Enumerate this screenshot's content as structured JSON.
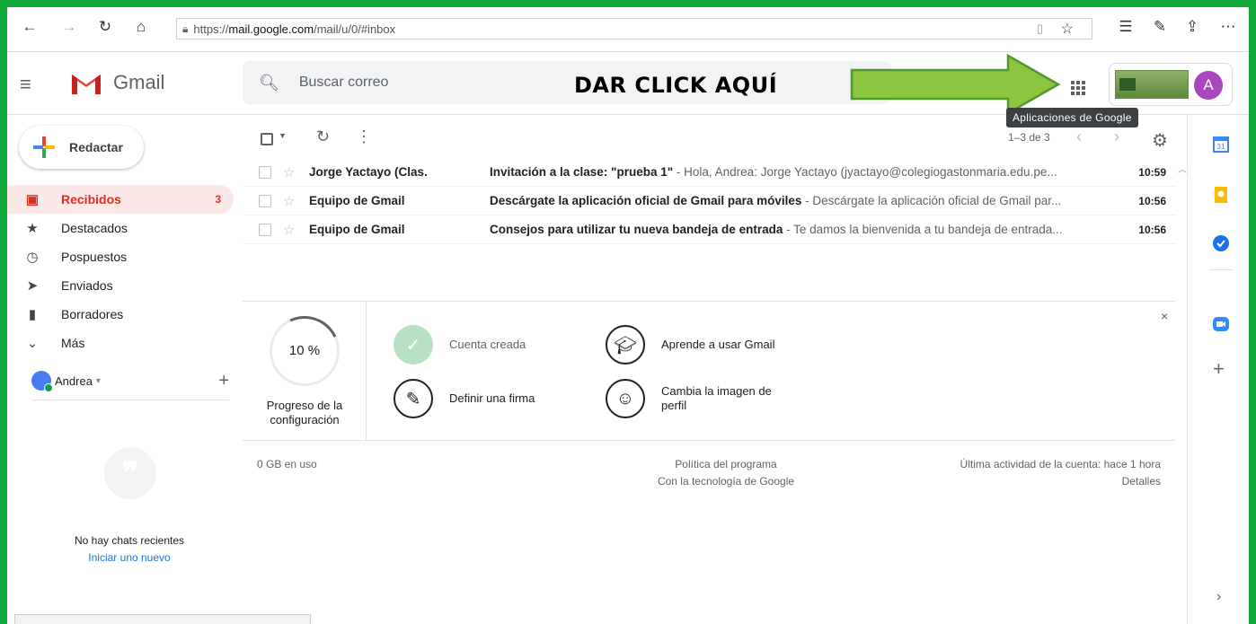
{
  "browser": {
    "url_prefix": "https://",
    "url_host": "mail.google.com",
    "url_path": "/mail/u/0/#inbox"
  },
  "header": {
    "app_name": "Gmail",
    "search_placeholder": "Buscar correo",
    "annotation": "DAR CLICK AQUÍ",
    "apps_tooltip": "Aplicaciones de Google",
    "avatar_letter": "A"
  },
  "compose_label": "Redactar",
  "nav": [
    {
      "label": "Recibidos",
      "count": "3"
    },
    {
      "label": "Destacados"
    },
    {
      "label": "Pospuestos"
    },
    {
      "label": "Enviados"
    },
    {
      "label": "Borradores"
    },
    {
      "label": "Más"
    }
  ],
  "user": {
    "name": "Andrea"
  },
  "chat": {
    "empty": "No hay chats recientes",
    "start_new": "Iniciar uno nuevo"
  },
  "toolbar": {
    "pager": "1–3 de 3"
  },
  "emails": [
    {
      "sender": "Jorge Yactayo (Clas.",
      "subject": "Invitación a la clase: \"prueba 1\"",
      "snippet": " - Hola, Andrea: Jorge Yactayo (jyactayo@colegiogastonmaria.edu.pe...",
      "time": "10:59"
    },
    {
      "sender": "Equipo de Gmail",
      "subject": "Descárgate la aplicación oficial de Gmail para móviles",
      "snippet": " - Descárgate la aplicación oficial de Gmail par...",
      "time": "10:56"
    },
    {
      "sender": "Equipo de Gmail",
      "subject": "Consejos para utilizar tu nueva bandeja de entrada",
      "snippet": " - Te damos la bienvenida a tu bandeja de entrada...",
      "time": "10:56"
    }
  ],
  "setup": {
    "percent": "10 %",
    "title": "Progreso de la configuración",
    "tasks": [
      {
        "label": "Cuenta creada"
      },
      {
        "label": "Aprende a usar Gmail"
      },
      {
        "label": "Definir una firma"
      },
      {
        "label": "Cambia la imagen de perfil"
      }
    ]
  },
  "footer": {
    "usage": "0 GB en uso",
    "policy": "Política del programa",
    "powered": "Con la tecnología de Google",
    "activity": "Última actividad de la cuenta: hace 1 hora",
    "details": "Detalles"
  },
  "colors": {
    "frame": "#11a83c",
    "arrow": "#8cc63f",
    "red": "#d93025",
    "link": "#1a73e8"
  }
}
